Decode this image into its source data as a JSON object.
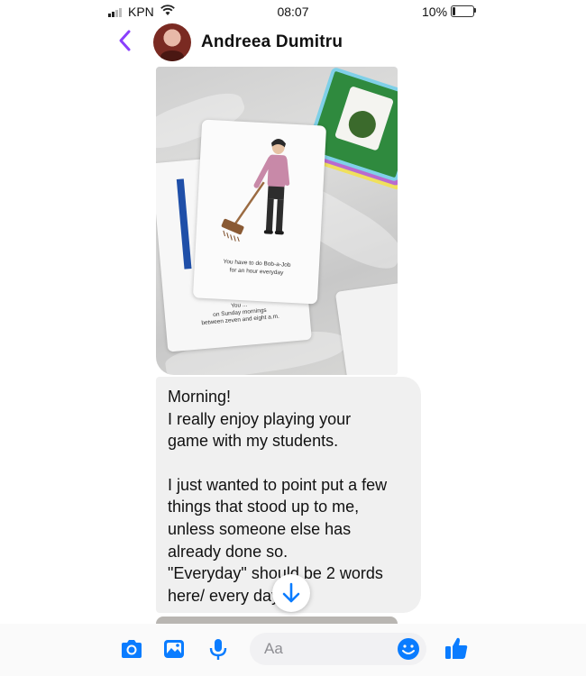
{
  "status_bar": {
    "carrier": "KPN",
    "time": "08:07",
    "battery": "10%"
  },
  "header": {
    "contact_name": "Andreea Dumitru"
  },
  "photo_message": {
    "back_card_text": [
      "You ...",
      "on Sunday mornings",
      "between zeven and eight a.m."
    ],
    "front_card_text": [
      "You have to do Bob-a-Job",
      "for an hour everyday"
    ]
  },
  "text_message": {
    "paragraphs": [
      [
        "Morning!",
        "I really enjoy playing your",
        "game with my students."
      ],
      [
        "I just wanted to point put a few",
        "things that stood up to me,",
        "unless someone else has",
        "already done so.",
        "\"Everyday\" should be 2 words",
        "here/ every day"
      ]
    ]
  },
  "composer": {
    "placeholder": "Aa"
  },
  "colors": {
    "accent": "#8a3ffc",
    "messenger_blue": "#0a7cff",
    "bubble_gray": "#f0f0f0"
  },
  "icons": [
    "back-arrow",
    "camera",
    "image",
    "microphone",
    "emoji",
    "thumbs-up",
    "arrow-down"
  ]
}
